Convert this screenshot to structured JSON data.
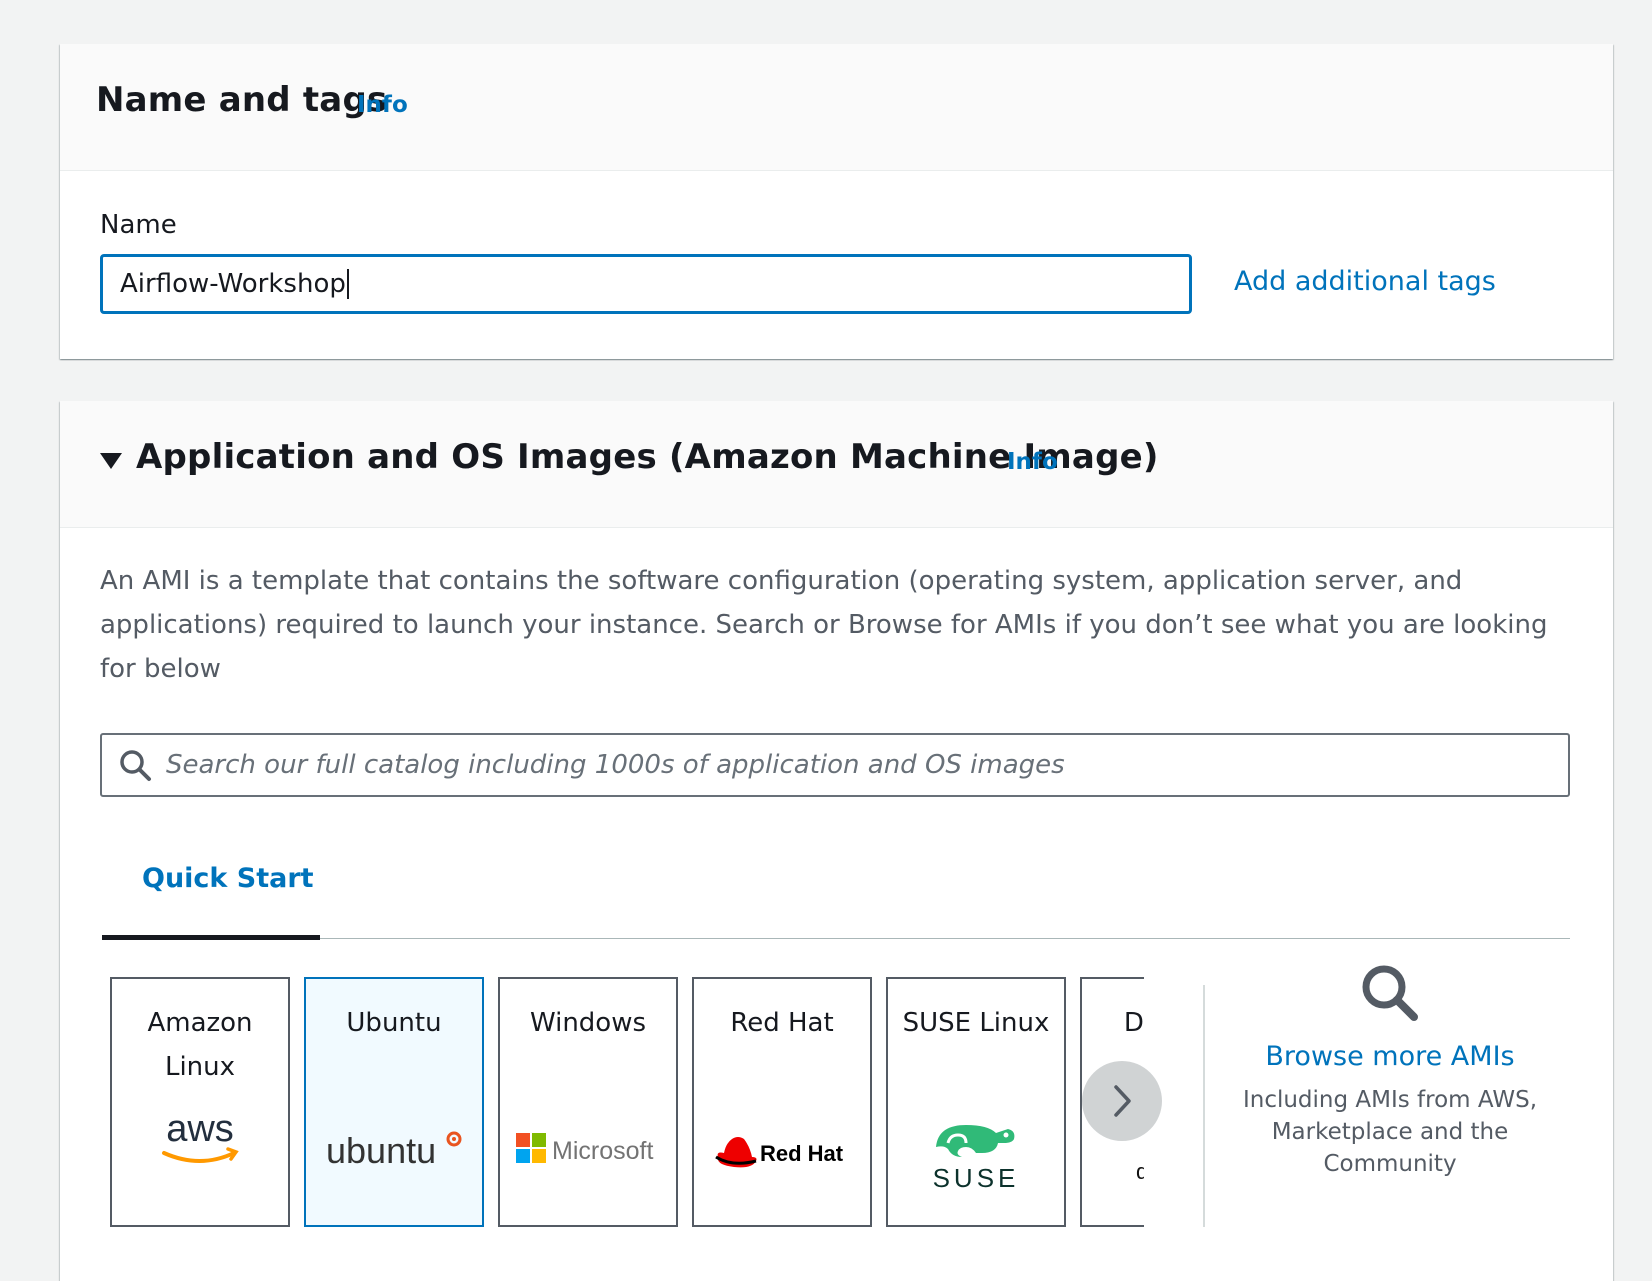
{
  "name_section": {
    "title": "Name and tags",
    "info": "Info",
    "name_label": "Name",
    "name_value": "Airflow-Workshop",
    "add_tags": "Add additional tags"
  },
  "ami_section": {
    "title": "Application and OS Images (Amazon Machine Image)",
    "info": "Info",
    "description": "An AMI is a template that contains the software configuration (operating system, application server, and applications) required to launch your instance. Search or Browse for AMIs if you don’t see what you are looking for below",
    "search_placeholder": "Search our full catalog including 1000s of application and OS images",
    "tab": "Quick Start",
    "cards": [
      {
        "title": "Amazon Linux",
        "logo_text": "aws",
        "icon": "aws-logo-icon"
      },
      {
        "title": "Ubuntu",
        "logo_text": "ubuntu",
        "icon": "ubuntu-logo-icon"
      },
      {
        "title": "Windows",
        "logo_text": "Microsoft",
        "icon": "microsoft-logo-icon"
      },
      {
        "title": "Red Hat",
        "logo_text": "Red Hat",
        "icon": "redhat-logo-icon"
      },
      {
        "title": "SUSE Linux",
        "logo_text": "SUSE",
        "icon": "suse-logo-icon"
      },
      {
        "title": "Debian",
        "logo_text": "debian",
        "icon": "debian-logo-icon"
      }
    ],
    "selected_card": "Ubuntu",
    "browse": {
      "link": "Browse more AMIs",
      "subtext": "Including AMIs from AWS, Marketplace and the Community"
    }
  },
  "colors": {
    "link": "#0073bb",
    "text": "#16191f",
    "muted": "#545b64",
    "background": "#f2f3f3"
  }
}
